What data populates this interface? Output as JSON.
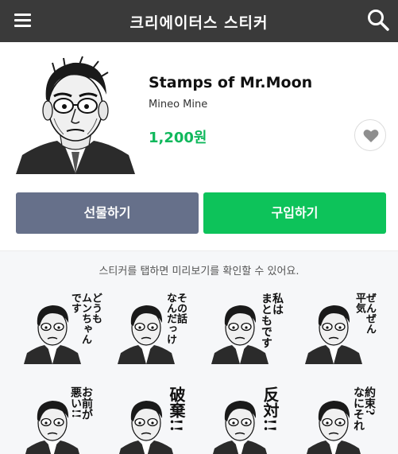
{
  "header": {
    "title": "크리에이터스 스티커",
    "menu_icon": "hamburger-menu-icon",
    "search_icon": "search-icon"
  },
  "product": {
    "name": "Stamps of Mr.Moon",
    "author": "Mineo Mine",
    "price": "1,200원",
    "like_icon": "heart-icon"
  },
  "buttons": {
    "gift": "선물하기",
    "buy": "구입하기"
  },
  "preview": {
    "hint": "스티커를 탭하면 미리보기를 확인할 수 있어요."
  },
  "stickers": [
    {
      "text": "どうも ムンちゃん です"
    },
    {
      "text": "その話 なんだっけ"
    },
    {
      "text": "私は まともです"
    },
    {
      "text": "ぜんぜん 平気"
    },
    {
      "text": "お前が 悪い!!"
    },
    {
      "text": "破棄!!"
    },
    {
      "text": "反対!!"
    },
    {
      "text": "約束? なにそれ"
    }
  ],
  "colors": {
    "header_bg": "#3a3a3a",
    "price": "#10b85c",
    "gift_button": "#66708a",
    "buy_button": "#0dc35a"
  }
}
